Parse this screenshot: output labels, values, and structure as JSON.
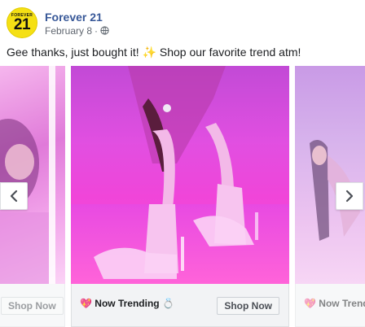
{
  "page": {
    "avatar_brand": "FOREVER",
    "avatar_number": "21",
    "name": "Forever 21",
    "date": "February 8",
    "separator": "·",
    "privacy_icon": "globe-icon"
  },
  "post": {
    "text": "Gee thanks, just bought it! ✨ Shop our favorite trend atm!"
  },
  "carousel": {
    "prev_icon": "chevron-left-icon",
    "next_icon": "chevron-right-icon",
    "cards": [
      {
        "headline": "",
        "cta": "Shop Now"
      },
      {
        "headline": "💖 Now Trending 💍",
        "cta": "Shop Now"
      },
      {
        "headline": "💖 Now Trend",
        "cta": ""
      }
    ]
  },
  "colors": {
    "link": "#385898",
    "avatar_bg": "#f5e014",
    "magenta": "#ff4fd6"
  }
}
